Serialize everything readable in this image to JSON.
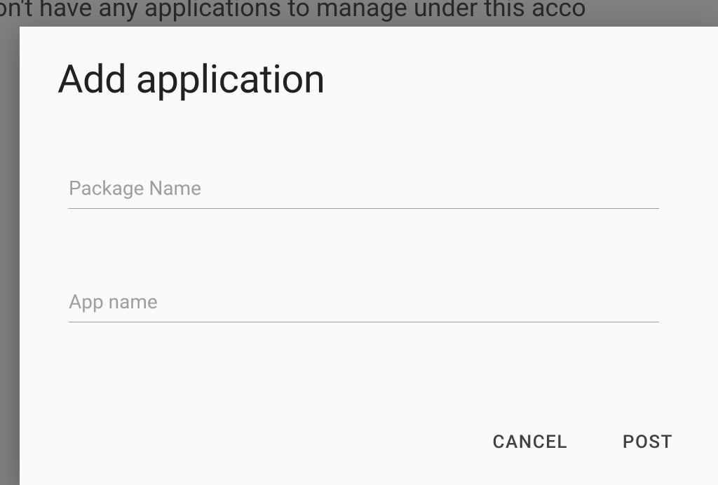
{
  "background": {
    "text": "don't have any applications to manage under this acco"
  },
  "dialog": {
    "title": "Add application",
    "fields": {
      "package_name": {
        "placeholder": "Package Name",
        "value": ""
      },
      "app_name": {
        "placeholder": "App name",
        "value": ""
      }
    },
    "actions": {
      "cancel": "CANCEL",
      "post": "POST"
    }
  }
}
